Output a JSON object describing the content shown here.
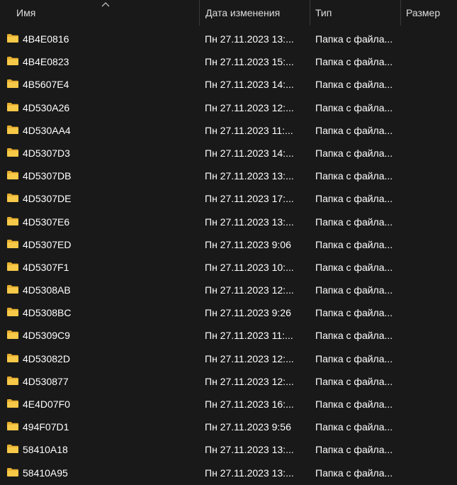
{
  "columns": {
    "name": "Имя",
    "date": "Дата изменения",
    "type": "Тип",
    "size": "Размер"
  },
  "colors": {
    "background": "#191919",
    "folder": "#f2c14e",
    "text": "#ffffff",
    "header_text": "#dedede"
  },
  "rows": [
    {
      "name": "4B4E0816",
      "date": "Пн 27.11.2023 13:...",
      "type": "Папка с файла...",
      "size": ""
    },
    {
      "name": "4B4E0823",
      "date": "Пн 27.11.2023 15:...",
      "type": "Папка с файла...",
      "size": ""
    },
    {
      "name": "4B5607E4",
      "date": "Пн 27.11.2023 14:...",
      "type": "Папка с файла...",
      "size": ""
    },
    {
      "name": "4D530A26",
      "date": "Пн 27.11.2023 12:...",
      "type": "Папка с файла...",
      "size": ""
    },
    {
      "name": "4D530AA4",
      "date": "Пн 27.11.2023 11:...",
      "type": "Папка с файла...",
      "size": ""
    },
    {
      "name": "4D5307D3",
      "date": "Пн 27.11.2023 14:...",
      "type": "Папка с файла...",
      "size": ""
    },
    {
      "name": "4D5307DB",
      "date": "Пн 27.11.2023 13:...",
      "type": "Папка с файла...",
      "size": ""
    },
    {
      "name": "4D5307DE",
      "date": "Пн 27.11.2023 17:...",
      "type": "Папка с файла...",
      "size": ""
    },
    {
      "name": "4D5307E6",
      "date": "Пн 27.11.2023 13:...",
      "type": "Папка с файла...",
      "size": ""
    },
    {
      "name": "4D5307ED",
      "date": "Пн 27.11.2023 9:06",
      "type": "Папка с файла...",
      "size": ""
    },
    {
      "name": "4D5307F1",
      "date": "Пн 27.11.2023 10:...",
      "type": "Папка с файла...",
      "size": ""
    },
    {
      "name": "4D5308AB",
      "date": "Пн 27.11.2023 12:...",
      "type": "Папка с файла...",
      "size": ""
    },
    {
      "name": "4D5308BC",
      "date": "Пн 27.11.2023 9:26",
      "type": "Папка с файла...",
      "size": ""
    },
    {
      "name": "4D5309C9",
      "date": "Пн 27.11.2023 11:...",
      "type": "Папка с файла...",
      "size": ""
    },
    {
      "name": "4D53082D",
      "date": "Пн 27.11.2023 12:...",
      "type": "Папка с файла...",
      "size": ""
    },
    {
      "name": "4D530877",
      "date": "Пн 27.11.2023 12:...",
      "type": "Папка с файла...",
      "size": ""
    },
    {
      "name": "4E4D07F0",
      "date": "Пн 27.11.2023 16:...",
      "type": "Папка с файла...",
      "size": ""
    },
    {
      "name": "494F07D1",
      "date": "Пн 27.11.2023 9:56",
      "type": "Папка с файла...",
      "size": ""
    },
    {
      "name": "58410A18",
      "date": "Пн 27.11.2023 13:...",
      "type": "Папка с файла...",
      "size": ""
    },
    {
      "name": "58410A95",
      "date": "Пн 27.11.2023 13:...",
      "type": "Папка с файла...",
      "size": ""
    }
  ]
}
